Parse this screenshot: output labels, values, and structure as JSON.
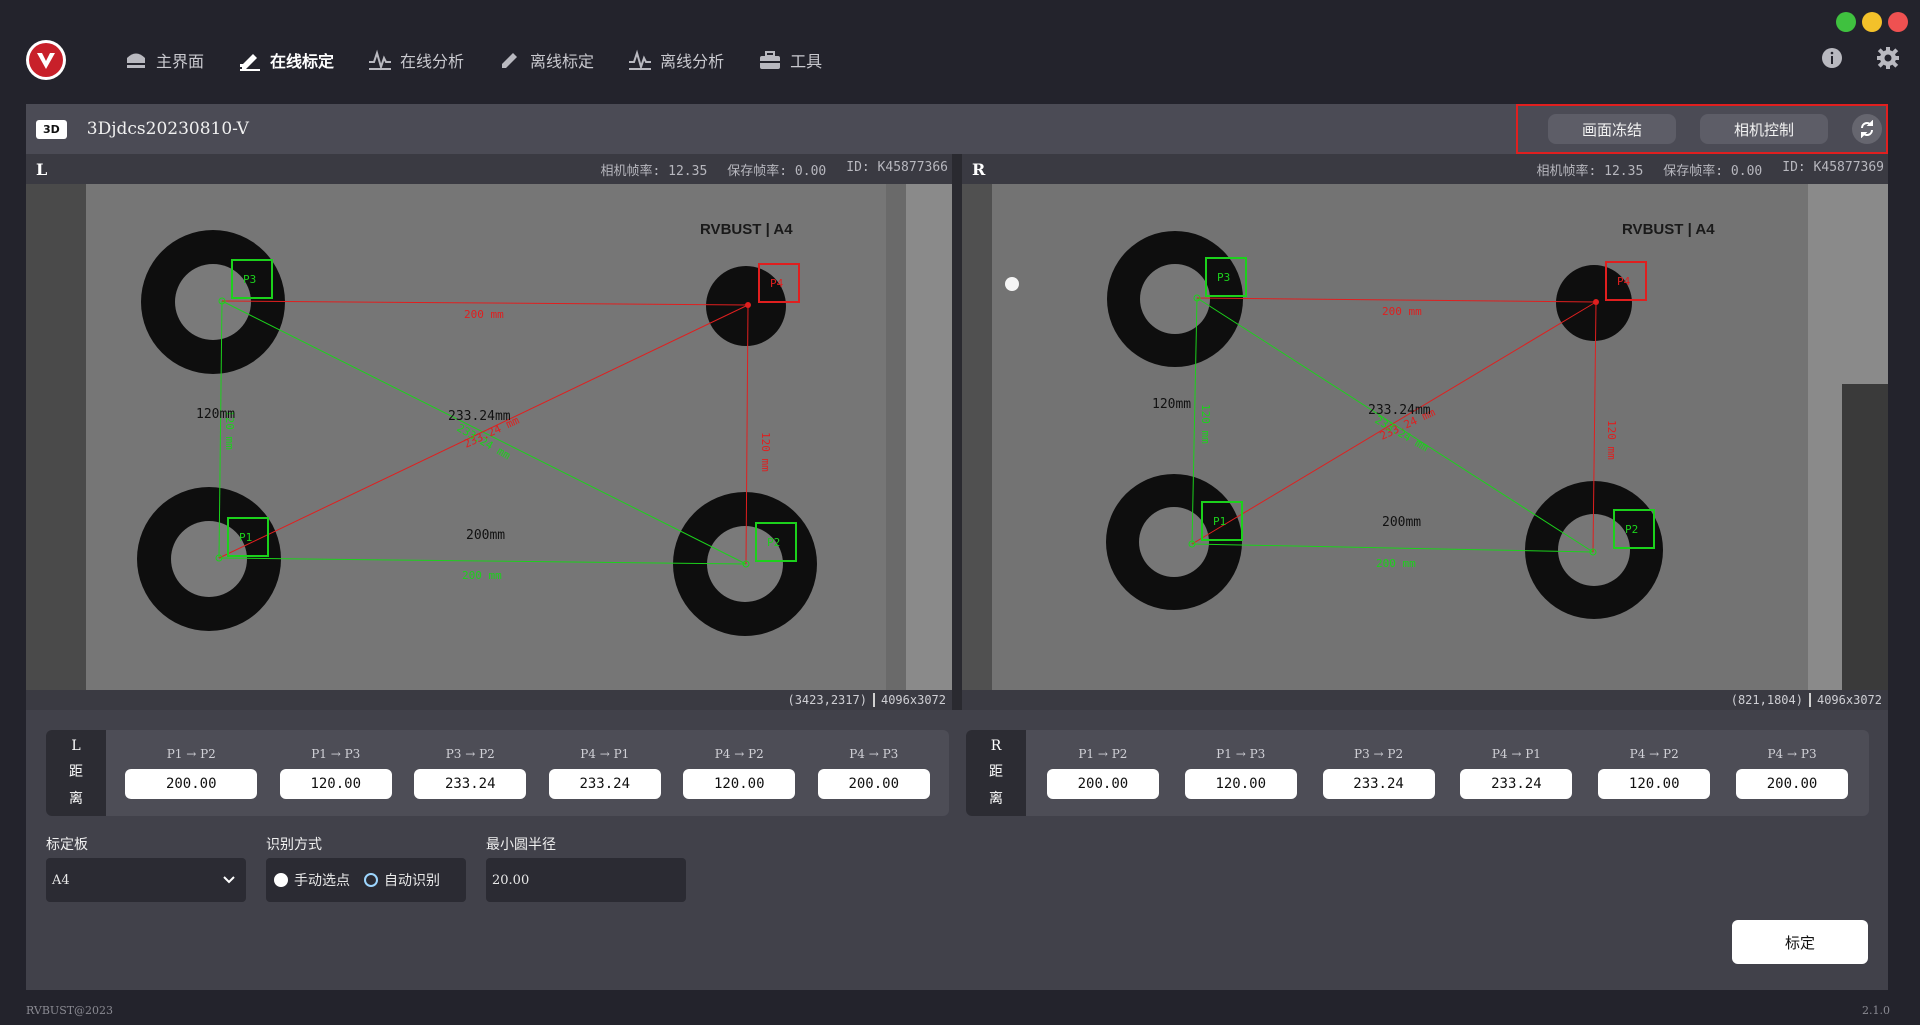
{
  "window_controls": [
    "#3fc13f",
    "#f3c12a",
    "#ef5151"
  ],
  "nav": {
    "items": [
      {
        "label": "主界面",
        "icon": "home-icon"
      },
      {
        "label": "在线标定",
        "icon": "pen-icon",
        "active": true
      },
      {
        "label": "在线分析",
        "icon": "wave-icon"
      },
      {
        "label": "离线标定",
        "icon": "pencil-icon"
      },
      {
        "label": "离线分析",
        "icon": "wave-icon"
      },
      {
        "label": "工具",
        "icon": "toolbox-icon"
      }
    ]
  },
  "header": {
    "badge": "3D",
    "device_name": "3Djdcs20230810-V",
    "freeze_label": "画面冻结",
    "camera_control_label": "相机控制"
  },
  "cams": {
    "left": {
      "side": "L",
      "fps": "相机帧率: 12.35",
      "save_fps": "保存帧率: 0.00",
      "id": "ID: K45877366",
      "cursor": "(3423,2317)",
      "resolution": "4096x3072",
      "brand": "RVBUST | A4",
      "labels": {
        "p1": "P1",
        "p2": "P2",
        "p3": "P3",
        "p4": "P4",
        "red_top": "200 mm",
        "red_right": "120 mm",
        "red_diag": "233.24 mm",
        "green_left": "120 mm",
        "green_bottom": "200 mm",
        "green_diag": "233.24 mm",
        "black_left": "120mm",
        "black_bottom": "200mm",
        "black_diag": "233.24mm"
      }
    },
    "right": {
      "side": "R",
      "fps": "相机帧率: 12.35",
      "save_fps": "保存帧率: 0.00",
      "id": "ID: K45877369",
      "cursor": "(821,1804)",
      "resolution": "4096x3072",
      "brand": "RVBUST | A4",
      "labels": {
        "p1": "P1",
        "p2": "P2",
        "p3": "P3",
        "p4": "P4",
        "red_top": "200 mm",
        "red_right": "120 mm",
        "red_diag": "233.24 mm",
        "green_left": "120 mm",
        "green_bottom": "200 mm",
        "green_diag": "233.24 mm",
        "black_left": "120mm",
        "black_bottom": "200mm",
        "black_diag": "233.24mm"
      }
    }
  },
  "distances": {
    "left": {
      "side": "L",
      "word1": "距",
      "word2": "离",
      "items": [
        {
          "label": "P1 → P2",
          "value": "200.00"
        },
        {
          "label": "P1 → P3",
          "value": "120.00"
        },
        {
          "label": "P3 → P2",
          "value": "233.24"
        },
        {
          "label": "P4 → P1",
          "value": "233.24"
        },
        {
          "label": "P4 → P2",
          "value": "120.00"
        },
        {
          "label": "P4 → P3",
          "value": "200.00"
        }
      ]
    },
    "right": {
      "side": "R",
      "word1": "距",
      "word2": "离",
      "items": [
        {
          "label": "P1 → P2",
          "value": "200.00"
        },
        {
          "label": "P1 → P3",
          "value": "120.00"
        },
        {
          "label": "P3 → P2",
          "value": "233.24"
        },
        {
          "label": "P4 → P1",
          "value": "233.24"
        },
        {
          "label": "P4 → P2",
          "value": "120.00"
        },
        {
          "label": "P4 → P3",
          "value": "200.00"
        }
      ]
    }
  },
  "settings": {
    "board_label": "标定板",
    "board_value": "A4",
    "method_label": "识别方式",
    "method_manual": "手动选点",
    "method_auto": "自动识别",
    "radius_label": "最小圆半径",
    "radius_value": "20.00",
    "calibrate_label": "标定"
  },
  "footer": {
    "copyright": "RVBUST@2023",
    "version": "2.1.0"
  }
}
